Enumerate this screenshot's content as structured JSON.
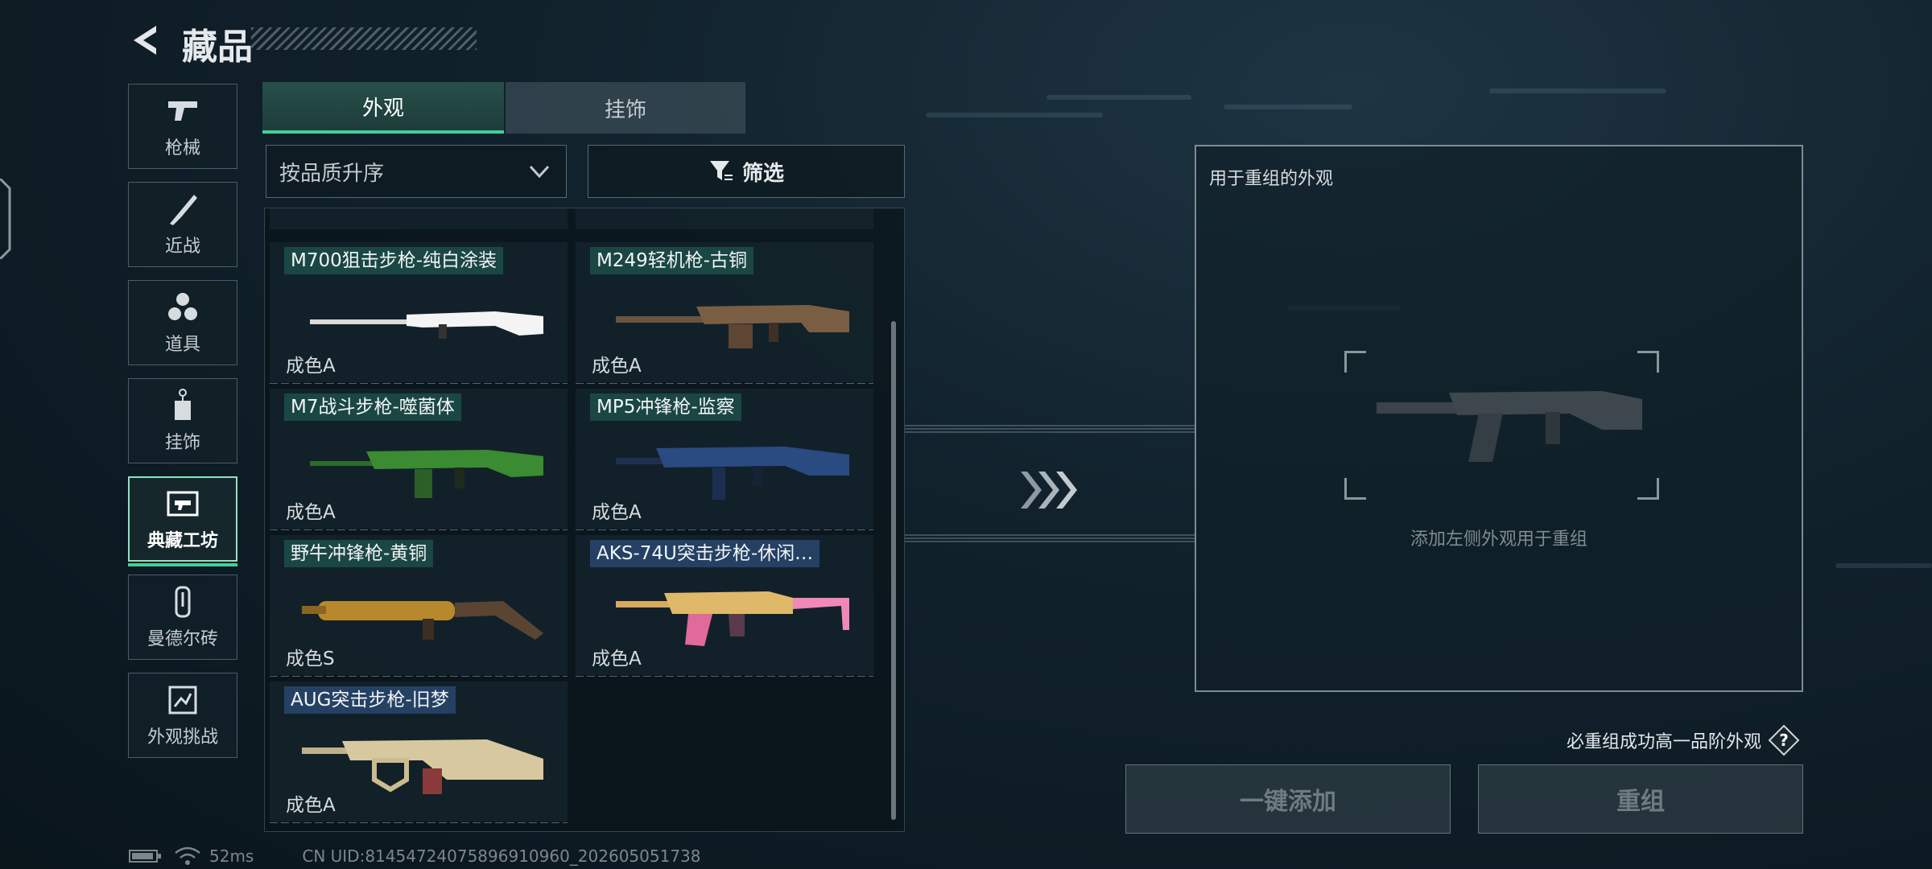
{
  "header": {
    "title": "藏品"
  },
  "sidebar": [
    {
      "label": "枪械",
      "icon": "gun-icon"
    },
    {
      "label": "近战",
      "icon": "knife-icon"
    },
    {
      "label": "道具",
      "icon": "grenade-icon"
    },
    {
      "label": "挂饰",
      "icon": "charm-icon"
    },
    {
      "label": "典藏工坊",
      "icon": "workshop-icon",
      "active": true
    },
    {
      "label": "曼德尔砖",
      "icon": "mandel-brick-icon"
    },
    {
      "label": "外观挑战",
      "icon": "challenge-icon"
    }
  ],
  "tabs": [
    {
      "label": "外观",
      "active": true
    },
    {
      "label": "挂饰",
      "active": false
    }
  ],
  "sort": {
    "label": "按品质升序"
  },
  "filter": {
    "label": "筛选"
  },
  "items": [
    {
      "name": "M700狙击步枪-纯白涂装",
      "grade": "成色A"
    },
    {
      "name": "M249轻机枪-古铜",
      "grade": "成色A"
    },
    {
      "name": "M7战斗步枪-噬菌体",
      "grade": "成色A"
    },
    {
      "name": "MP5冲锋枪-监察",
      "grade": "成色A"
    },
    {
      "name": "野牛冲锋枪-黄铜",
      "grade": "成色S"
    },
    {
      "name": "AKS-74U突击步枪-休闲…",
      "grade": "成色A"
    },
    {
      "name": "AUG突击步枪-旧梦",
      "grade": "成色A"
    }
  ],
  "reform": {
    "title": "用于重组的外观",
    "hint": "添加左侧外观用于重组",
    "note": "必重组成功高一品阶外观",
    "help": "?",
    "add_button": "一键添加",
    "reform_button": "重组"
  },
  "status": {
    "ping": "52ms",
    "uid": "CN UID:81454724075896910960_202605051738"
  },
  "colors": {
    "accent": "#3fd19a",
    "name_tag_green": "#1c4e48",
    "name_tag_blue": "#284670"
  }
}
